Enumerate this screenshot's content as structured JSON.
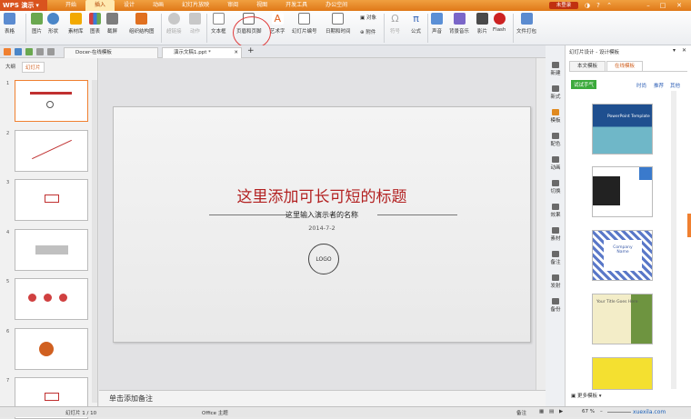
{
  "app": {
    "logo_label": "WPS 演示",
    "login": "未登录"
  },
  "menu": [
    "开始",
    "插入",
    "设计",
    "动画",
    "幻灯片放映",
    "审阅",
    "视图",
    "开发工具",
    "办公空间"
  ],
  "menu_active": "插入",
  "ribbon": {
    "items": [
      "表格",
      "图片",
      "形状",
      "素材库",
      "图表",
      "截屏",
      "组织结构图",
      "超链接",
      "动作",
      "文本框",
      "页眉和页脚",
      "艺术字",
      "幻灯片编号",
      "日期和时间",
      "对象",
      "附件",
      "符号",
      "公式",
      "声音",
      "背景音乐",
      "影片",
      "Flash",
      "文件打包"
    ]
  },
  "tabs": {
    "doc1": "Docer-在线模板",
    "doc2": "演示文稿1.ppt *",
    "add": "+"
  },
  "left_tabs": [
    "大纲",
    "幻灯片"
  ],
  "thumbs": [
    "1",
    "2",
    "3",
    "4",
    "5",
    "6",
    "7"
  ],
  "slide": {
    "title": "这里添加可长可短的标题",
    "subtitle": "这里输入演示者的名称",
    "date": "2014-7-2",
    "logo": "LOGO"
  },
  "notes": "单击添加备注",
  "side_icons": [
    "新建",
    "新式",
    "模板",
    "配色",
    "动画",
    "切换",
    "效果",
    "素材",
    "备注",
    "发射",
    "备份"
  ],
  "right_pane": {
    "title": "幻灯片设计 - 设计模板",
    "tabs": [
      "本文模板",
      "在线模板"
    ],
    "badge": "试试手气",
    "filters": [
      "时尚",
      "推荐",
      "其他"
    ],
    "template1": "PowerPoint Template",
    "template3_line1": "Company",
    "template3_line2": "Name",
    "template4": "Your Title Goes Here",
    "more": "更多模板"
  },
  "status": {
    "slide_num": "幻灯片 1 / 10",
    "theme": "Office 主题",
    "notes_btn": "备注",
    "zoom": "67 %",
    "watermark": "xuexila.com"
  }
}
